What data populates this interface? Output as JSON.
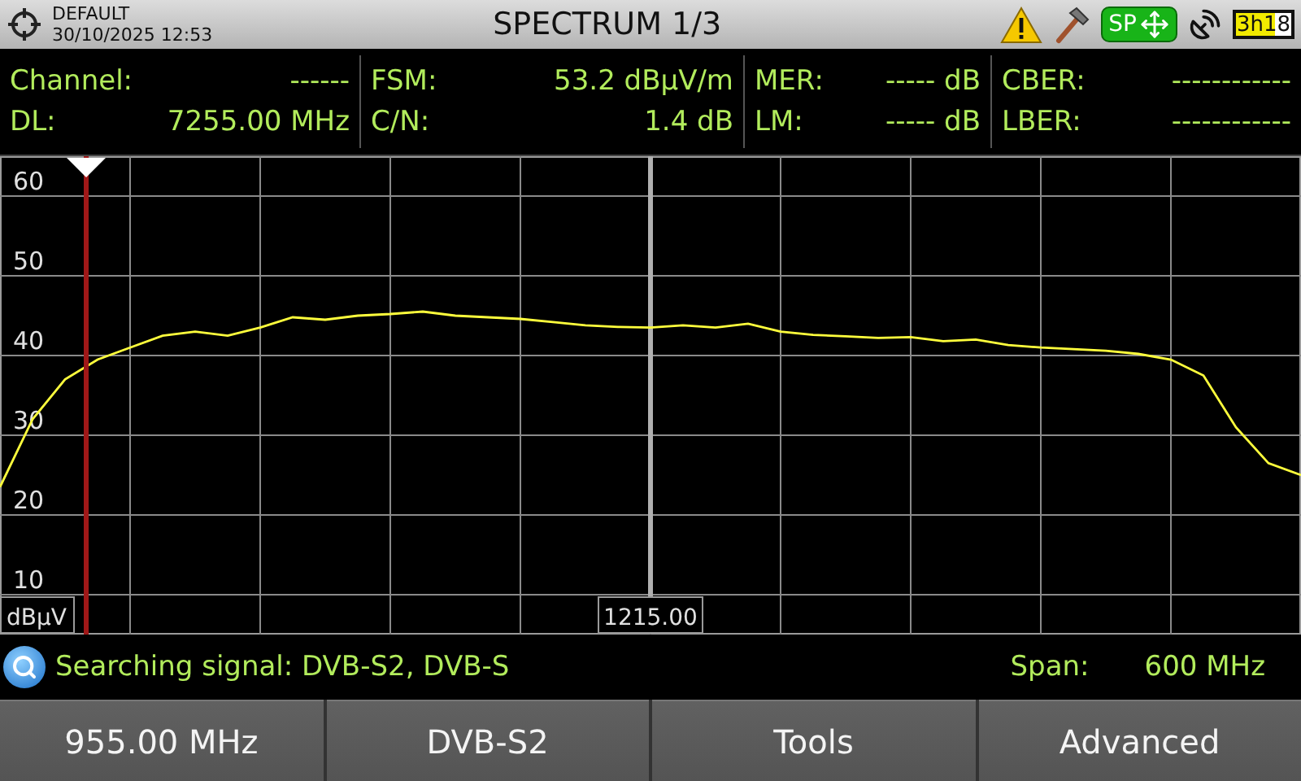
{
  "top_bar": {
    "preset": "DEFAULT",
    "datetime": "30/10/2025 12:53",
    "title": "SPECTRUM 1/3",
    "sp_label": "SP",
    "battery": "3h18"
  },
  "measurements": [
    [
      {
        "label": "Channel:",
        "value": "------"
      },
      {
        "label": "DL:",
        "value": "7255.00 MHz"
      }
    ],
    [
      {
        "label": "FSM:",
        "value": "53.2 dBμV/m"
      },
      {
        "label": "C/N:",
        "value": "1.4 dB"
      }
    ],
    [
      {
        "label": "MER:",
        "value": "----- dB"
      },
      {
        "label": "LM:",
        "value": "----- dB"
      }
    ],
    [
      {
        "label": "CBER:",
        "value": "------------"
      },
      {
        "label": "LBER:",
        "value": "------------"
      }
    ]
  ],
  "spectrum": {
    "chart_data": {
      "type": "line",
      "ylabel": "dBμV",
      "ylim": [
        5,
        65
      ],
      "yticks": [
        10,
        20,
        30,
        40,
        50,
        60
      ],
      "grid": true,
      "series": [
        {
          "color": "#ffff3c",
          "values": [
            23.5,
            32,
            37,
            39.5,
            41,
            42.5,
            43,
            42.5,
            43.5,
            44.8,
            44.5,
            45,
            45.2,
            45.5,
            45,
            44.8,
            44.6,
            44.2,
            43.8,
            43.6,
            43.5,
            43.8,
            43.5,
            44,
            43,
            42.6,
            42.4,
            42.2,
            42.3,
            41.8,
            42,
            41.3,
            41,
            40.8,
            40.6,
            40.2,
            39.5,
            37.5,
            31,
            26.5,
            25
          ]
        }
      ],
      "annotations": [
        "1215.00"
      ]
    }
  },
  "status": {
    "message": "Searching signal: DVB-S2, DVB-S",
    "span_label": "Span:",
    "span_value": "600 MHz"
  },
  "buttons": [
    "955.00 MHz",
    "DVB-S2",
    "Tools",
    "Advanced"
  ]
}
